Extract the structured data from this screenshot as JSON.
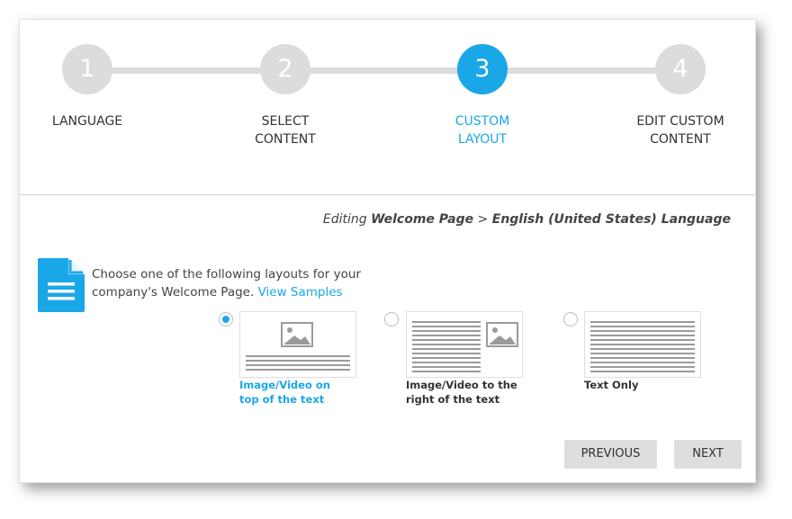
{
  "wizard": {
    "steps": [
      {
        "number": "1",
        "label_line1": "LANGUAGE",
        "label_line2": ""
      },
      {
        "number": "2",
        "label_line1": "SELECT",
        "label_line2": "CONTENT"
      },
      {
        "number": "3",
        "label_line1": "CUSTOM",
        "label_line2": "LAYOUT",
        "active": true
      },
      {
        "number": "4",
        "label_line1": "EDIT CUSTOM",
        "label_line2": "CONTENT"
      }
    ]
  },
  "editing": {
    "prefix": "Editing",
    "page": "Welcome Page",
    "separator": ">",
    "language": "English (United States) Language"
  },
  "intro": {
    "text": "Choose one of the following layouts for your company's Welcome Page.",
    "link": "View Samples"
  },
  "layouts": [
    {
      "line1": "Image/Video on",
      "line2": "top of the text",
      "selected": true
    },
    {
      "line1": "Image/Video to the",
      "line2": "right of the text",
      "selected": false
    },
    {
      "line1": "Text Only",
      "line2": "",
      "selected": false
    }
  ],
  "buttons": {
    "previous": "PREVIOUS",
    "next": "NEXT"
  },
  "colors": {
    "accent": "#1aa7e8",
    "inactive_step": "#dcdcdc",
    "button_bg": "#dedede"
  },
  "icons": {
    "document": "document-icon",
    "image": "image-placeholder-icon"
  }
}
